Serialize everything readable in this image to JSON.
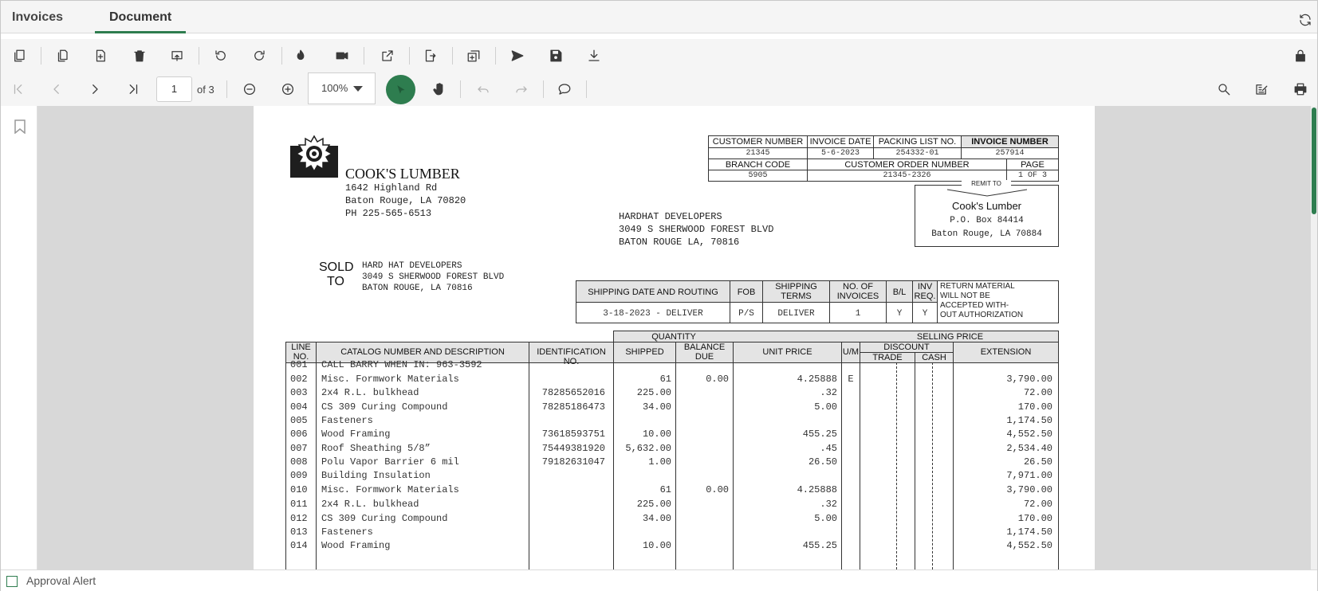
{
  "tabs": [
    {
      "label": "Invoices"
    },
    {
      "label": "Document"
    }
  ],
  "toolbar": {
    "page_number": "1",
    "page_of": "of 3",
    "zoom": "100%"
  },
  "footer": {
    "approval_label": "Approval Alert"
  },
  "invoice": {
    "company": {
      "name": "COOK'S LUMBER",
      "address1": "1642 Highland Rd",
      "address2": "Baton Rouge, LA 70820",
      "phone": "PH 225-565-6513"
    },
    "header_table": {
      "h_customer_number": "CUSTOMER NUMBER",
      "h_invoice_date": "INVOICE DATE",
      "h_packing_list": "PACKING LIST NO.",
      "h_invoice_number": "INVOICE NUMBER",
      "customer_number": "21345",
      "invoice_date": "5-6-2023",
      "packing_list": "254332-01",
      "invoice_number": "257914",
      "h_branch_code": "BRANCH CODE",
      "h_customer_order": "CUSTOMER ORDER NUMBER",
      "h_page": "PAGE",
      "branch_code": "5905",
      "customer_order": "21345-2326",
      "page": "1 OF 3"
    },
    "remit": {
      "label": "REMIT TO",
      "name": "Cook's Lumber",
      "address1": "P.O. Box 84414",
      "address2": "Baton Rouge, LA 70884"
    },
    "ship_to": {
      "line1": "HARDHAT DEVELOPERS",
      "line2": "3049 S SHERWOOD FOREST BLVD",
      "line3": "BATON ROUGE LA, 70816"
    },
    "sold_to": {
      "label1": "SOLD",
      "label2": "TO",
      "line1": "HARD HAT DEVELOPERS",
      "line2": "3049 S SHERWOOD FOREST BLVD",
      "line3": "BATON ROUGE, LA 70816"
    },
    "shipping": {
      "h_routing": "SHIPPING DATE AND ROUTING",
      "h_fob": "FOB",
      "h_terms1": "SHIPPING",
      "h_terms2": "TERMS",
      "h_invoices1": "NO. OF",
      "h_invoices2": "INVOICES",
      "h_bl": "B/L",
      "h_inv1": "INV",
      "h_inv2": "REQ.",
      "routing": "3-18-2023 - DELIVER",
      "fob": "P/S",
      "terms": "DELIVER",
      "invoices": "1",
      "bl": "Y",
      "inv_req": "Y",
      "note1": "RETURN MATERIAL",
      "note2": "WILL NOT BE",
      "note3": "ACCEPTED WITH-",
      "note4": "OUT AUTHORIZATION"
    },
    "items_header": {
      "quantity": "QUANTITY",
      "selling_price": "SELLING PRICE",
      "line1": "LINE",
      "line2": "NO.",
      "catalog": "CATALOG NUMBER AND DESCRIPTION",
      "ident": "IDENTIFICATION NO.",
      "shipped": "SHIPPED",
      "balance1": "BALANCE",
      "balance2": "DUE",
      "unit_price": "UNIT PRICE",
      "um": "U/M",
      "discount": "DISCOUNT",
      "trade": "TRADE",
      "cash": "CASH",
      "extension": "EXTENSION"
    },
    "lines": [
      {
        "no": "001",
        "desc": "CALL BARRY WHEN IN: 963-3592",
        "ident": "",
        "shipped": "",
        "balance": "",
        "unit": "",
        "um": "",
        "ext": ""
      },
      {
        "no": "002",
        "desc": "Misc. Formwork Materials",
        "ident": "",
        "shipped": "61",
        "balance": "0.00",
        "unit": "4.25888",
        "um": "E",
        "ext": "3,790.00"
      },
      {
        "no": "003",
        "desc": "2x4 R.L. bulkhead",
        "ident": "78285652016",
        "shipped": "225.00",
        "balance": "",
        "unit": ".32",
        "um": "",
        "ext": "72.00"
      },
      {
        "no": "004",
        "desc": "CS 309 Curing Compound",
        "ident": "78285186473",
        "shipped": "34.00",
        "balance": "",
        "unit": "5.00",
        "um": "",
        "ext": "170.00"
      },
      {
        "no": "005",
        "desc": "Fasteners",
        "ident": "",
        "shipped": "",
        "balance": "",
        "unit": "",
        "um": "",
        "ext": "1,174.50"
      },
      {
        "no": "006",
        "desc": "Wood Framing",
        "ident": "73618593751",
        "shipped": "10.00",
        "balance": "",
        "unit": "455.25",
        "um": "",
        "ext": "4,552.50"
      },
      {
        "no": "007",
        "desc": "Roof Sheathing 5/8”",
        "ident": "75449381920",
        "shipped": "5,632.00",
        "balance": "",
        "unit": ".45",
        "um": "",
        "ext": "2,534.40"
      },
      {
        "no": "008",
        "desc": "Polu Vapor Barrier 6 mil",
        "ident": "79182631047",
        "shipped": "1.00",
        "balance": "",
        "unit": "26.50",
        "um": "",
        "ext": "26.50"
      },
      {
        "no": "009",
        "desc": "Building Insulation",
        "ident": "",
        "shipped": "",
        "balance": "",
        "unit": "",
        "um": "",
        "ext": "7,971.00"
      },
      {
        "no": "010",
        "desc": "Misc. Formwork Materials",
        "ident": "",
        "shipped": "61",
        "balance": "0.00",
        "unit": "4.25888",
        "um": "",
        "ext": "3,790.00"
      },
      {
        "no": "011",
        "desc": "2x4 R.L. bulkhead",
        "ident": "",
        "shipped": "225.00",
        "balance": "",
        "unit": ".32",
        "um": "",
        "ext": "72.00"
      },
      {
        "no": "012",
        "desc": "CS 309 Curing Compound",
        "ident": "",
        "shipped": "34.00",
        "balance": "",
        "unit": "5.00",
        "um": "",
        "ext": "170.00"
      },
      {
        "no": "013",
        "desc": "Fasteners",
        "ident": "",
        "shipped": "",
        "balance": "",
        "unit": "",
        "um": "",
        "ext": "1,174.50"
      },
      {
        "no": "014",
        "desc": "Wood Framing",
        "ident": "",
        "shipped": "10.00",
        "balance": "",
        "unit": "455.25",
        "um": "",
        "ext": "4,552.50"
      }
    ]
  },
  "colors": {
    "accent": "#2e7d4f",
    "viewer_bg": "#d8d8d8"
  }
}
